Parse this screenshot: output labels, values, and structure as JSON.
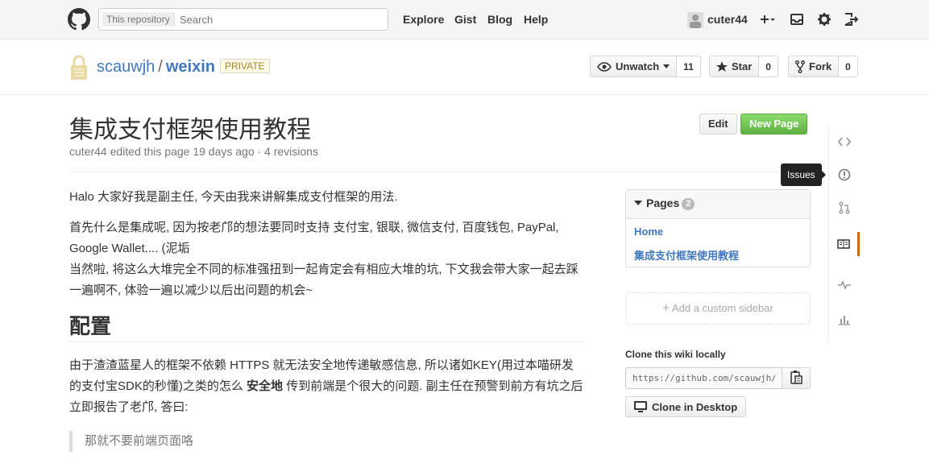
{
  "header": {
    "search_scope": "This repository",
    "search_placeholder": "Search",
    "nav": [
      "Explore",
      "Gist",
      "Blog",
      "Help"
    ],
    "username": "cuter44"
  },
  "repo": {
    "owner": "scauwjh",
    "separator": "/",
    "name": "weixin",
    "visibility": "PRIVATE",
    "unwatch_label": "Unwatch",
    "unwatch_count": "11",
    "star_label": "Star",
    "star_count": "0",
    "fork_label": "Fork",
    "fork_count": "0"
  },
  "page": {
    "title": "集成支付框架使用教程",
    "meta": "cuter44 edited this page 19 days ago · 4 revisions",
    "edit_label": "Edit",
    "new_page_label": "New Page"
  },
  "content": {
    "p1": "Halo 大家好我是副主任, 今天由我来讲解集成支付框架的用法.",
    "p2a": "首先什么是集成呢, 因为按老邝的想法要同时支持 支付宝, 银联, 微信支付, 百度钱包, PayPal, Google Wallet.... (泥垢",
    "p2b": "当然啦, 将这么大堆完全不同的标准强扭到一起肯定会有相应大堆的坑, 下文我会带大家一起去踩一遍啊不, 体验一遍以减少以后出问题的机会~",
    "h2": "配置",
    "p3_pre": "由于渣渣蓝星人的框架不依赖 HTTPS 就无法安全地传递敏感信息, 所以诸如KEY(用过本喵研发的支付宝SDK的秒懂)之类的怎么 ",
    "p3_bold": "安全地",
    "p3_post": " 传到前端是个很大的问题. 副主任在预警到前方有坑之后立即报告了老邝, 答曰:",
    "quote": "那就不要前端页面咯"
  },
  "sidebar": {
    "pages_title": "Pages",
    "pages_count": "2",
    "pages": [
      "Home",
      "集成支付框架使用教程"
    ],
    "add_custom": "Add a custom sidebar",
    "clone_title": "Clone this wiki locally",
    "clone_url": "https://github.com/scauwjh/weixin.wiki.git",
    "clone_desktop": "Clone in Desktop"
  },
  "rail": {
    "tooltip": "Issues",
    "items": [
      "code-icon",
      "issues-icon",
      "pull-request-icon",
      "wiki-icon",
      "pulse-icon",
      "graphs-icon"
    ]
  },
  "colors": {
    "link": "#4078c0",
    "accent": "#d26911",
    "new_page_green": "#60b044"
  }
}
